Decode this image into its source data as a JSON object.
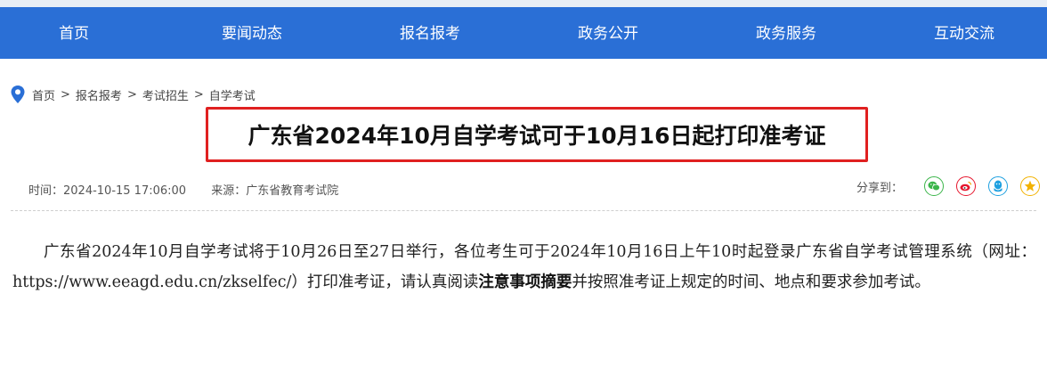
{
  "nav": {
    "items": [
      {
        "label": "首页"
      },
      {
        "label": "要闻动态"
      },
      {
        "label": "报名报考"
      },
      {
        "label": "政务公开"
      },
      {
        "label": "政务服务"
      },
      {
        "label": "互动交流"
      }
    ],
    "bg_color": "#2a6fd6"
  },
  "breadcrumb": {
    "items": [
      "首页",
      "报名报考",
      "考试招生",
      "自学考试"
    ],
    "separator": ">"
  },
  "article": {
    "title": "广东省2024年10月自学考试可于10月16日起打印准考证",
    "time": "时间：2024-10-15 17:06:00",
    "source": "来源：广东省教育考试院",
    "body_part1": "广东省2024年10月自学考试将于10月26日至27日举行，各位考生可于2024年10月16日上午10时起登录广东省自学考试管理系统（网址：https://www.eeagd.edu.cn/zkselfec/）打印准考证，请认真阅读",
    "body_bold": "注意事项摘要",
    "body_part2": "并按照准考证上规定的时间、地点和要求参加考试。"
  },
  "share": {
    "label": "分享到：",
    "icons": [
      "wechat-icon",
      "weibo-icon",
      "qq-icon",
      "qzone-icon"
    ],
    "colors": {
      "wechat": "#3bb54a",
      "weibo": "#e6162d",
      "qq": "#1ea0e0",
      "qzone": "#f2b200"
    }
  },
  "highlight_color": "#e02020"
}
